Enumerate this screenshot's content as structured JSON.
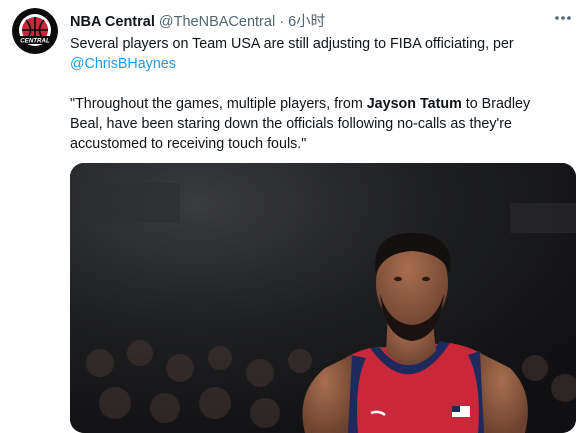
{
  "account": {
    "name": "NBA Central",
    "handle": "@TheNBACentral",
    "separator": "·",
    "time": "6小时",
    "avatar_text": "CENTRAL"
  },
  "tweet": {
    "line1": "Several players on Team USA are still adjusting to FIBA officiating, per",
    "mention": "@ChrisBHaynes",
    "quote_part1": "\"Throughout the games, multiple players, from ",
    "quote_bold1": "Jayson Tatum",
    "quote_part2": " to Bradley Beal, have been staring down the officials following no-calls as they're accustomed to receiving touch fouls.\""
  },
  "colors": {
    "link": "#1d9bf0",
    "secondary": "#536471",
    "jersey_red": "#c8283a",
    "jersey_navy": "#1f2a5c"
  },
  "icons": {
    "more": "more-icon",
    "avatar": "basketball-logo"
  }
}
